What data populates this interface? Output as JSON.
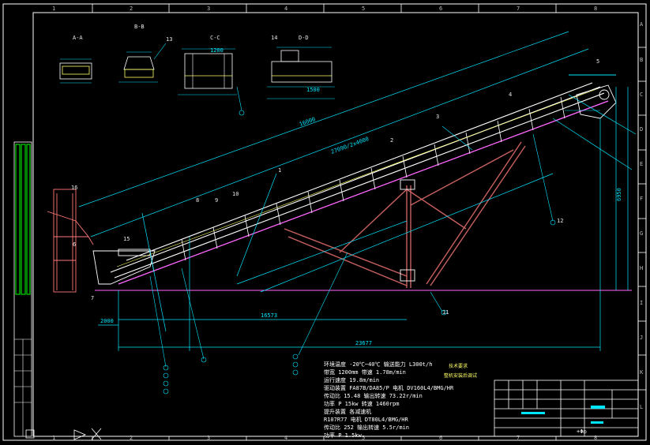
{
  "border": {
    "columns": [
      "1",
      "2",
      "3",
      "4",
      "5",
      "6",
      "7",
      "8"
    ],
    "rows": [
      "A",
      "B",
      "C",
      "D",
      "E",
      "F",
      "G",
      "H",
      "I",
      "J",
      "K",
      "L"
    ]
  },
  "views": {
    "aa": "A-A",
    "bb": "B-B",
    "cc": "C-C",
    "dd": "D-D"
  },
  "dimensions": {
    "total_length": "23677",
    "horizontal": "16573",
    "incline": "27090/2x4000",
    "frame_len": "16000",
    "left_offset": "2000",
    "vert_right": "6950",
    "small_a": "1200",
    "small_b": "1500"
  },
  "callouts": [
    "1",
    "2",
    "3",
    "4",
    "5",
    "6",
    "7",
    "8",
    "9",
    "10",
    "11",
    "12",
    "13",
    "14",
    "15",
    "16"
  ],
  "notes": {
    "temp": "环境温度 -20℃~40℃  输送能力 L300t/h",
    "belt": "带宽 1200mm  带速 1.78m/min",
    "speed": "运行速度 19.8m/min",
    "drive": "驱动装置 FA87B/DA85/P  电机 DV160L4/BMG/HR",
    "ratio": "传动比 15.48  输出转速 73.22r/min",
    "power": "功率 P 15kw  转速 1460rpm",
    "lift_hdr": "提升装置 各减速机",
    "lift": "R107R77  电机 DT80L4/BMG/HR",
    "ratio2": "传动比 252  输出转速 5.5r/min",
    "power2": "功率 P 1.5kw"
  },
  "tech_req": {
    "title": "技术要求",
    "line1": "整机安装后调试"
  },
  "title_block": {
    "drawing_no": "",
    "logo_text": "+Φ◎"
  },
  "colors": {
    "bg": "#000000",
    "frame": "#ffffff",
    "dim": "#00e5ff",
    "beam": "#ff66ff",
    "truss": "#c86060",
    "green": "#00ff00",
    "yellow": "#ffff00"
  }
}
